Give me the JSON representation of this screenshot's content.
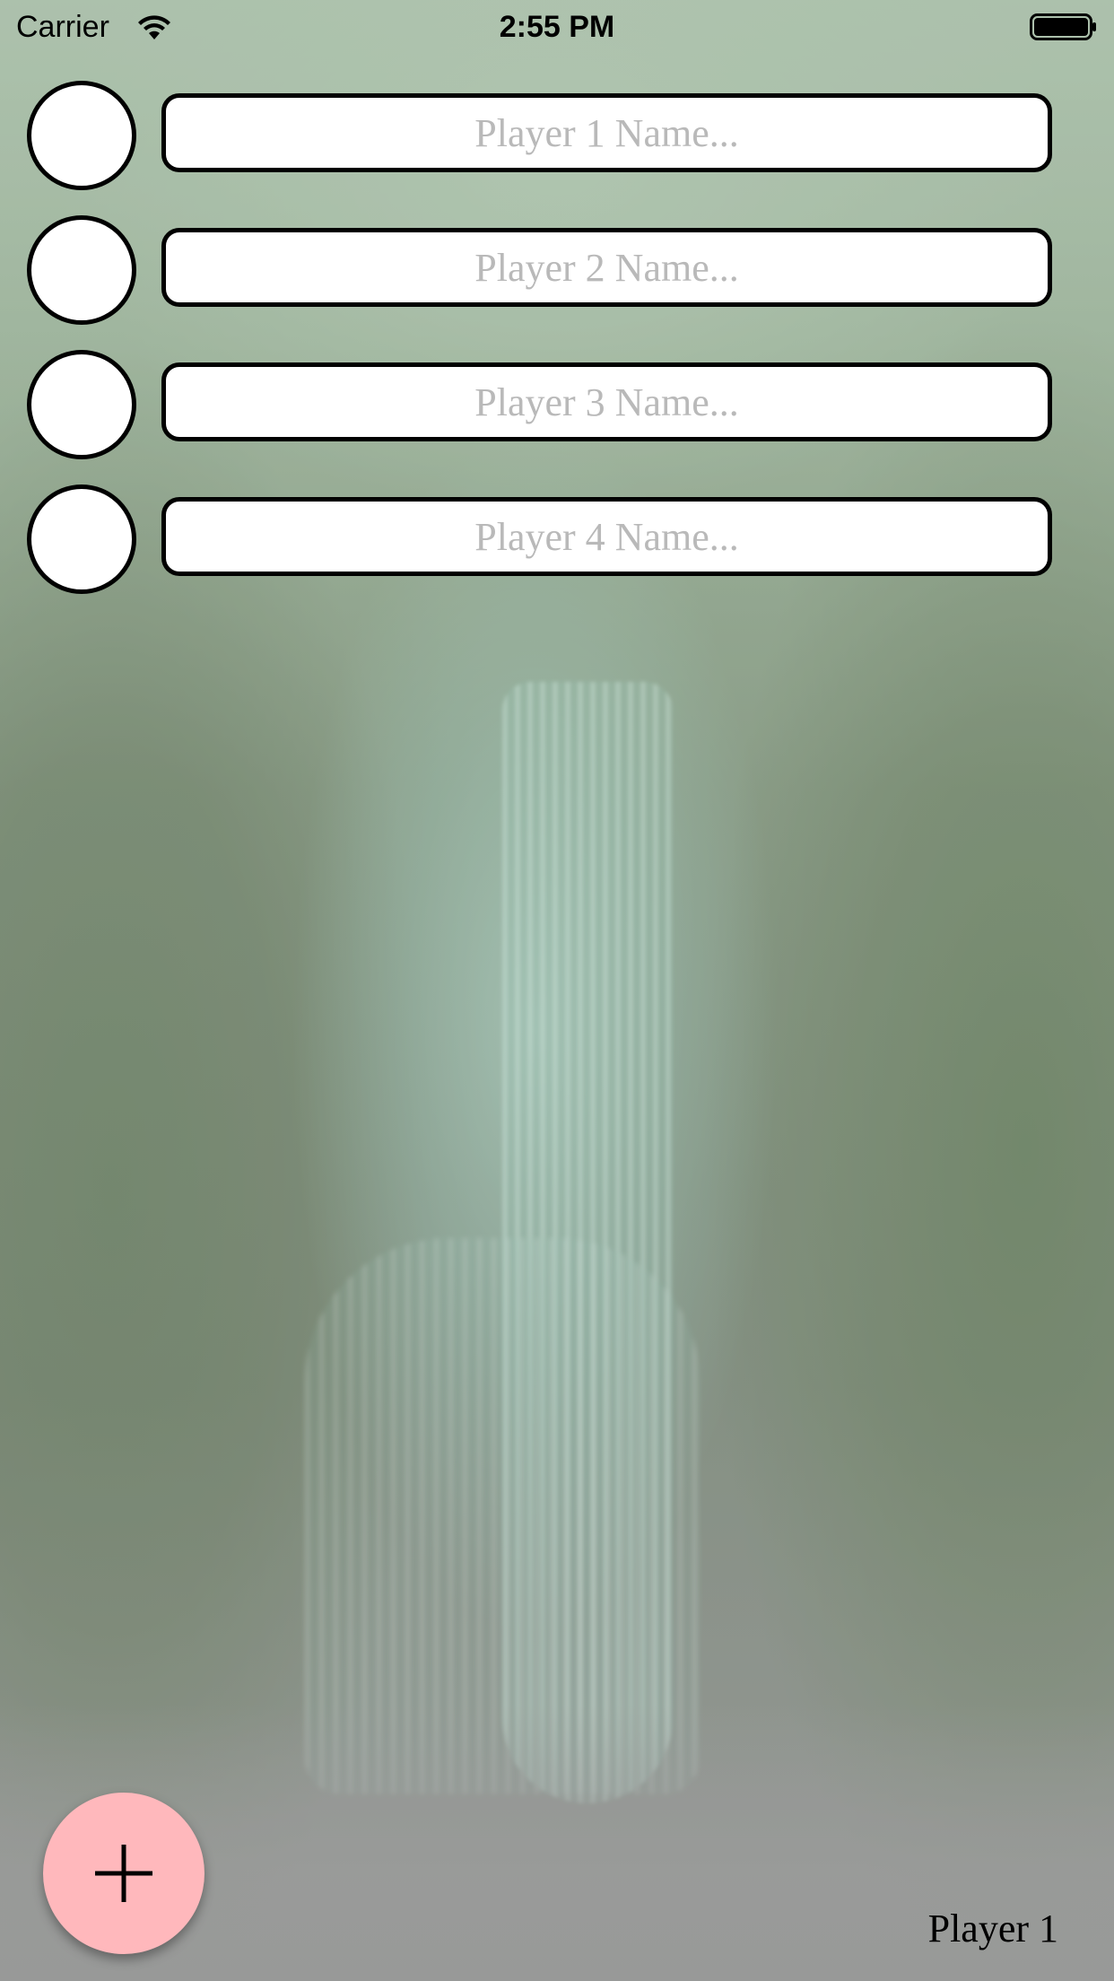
{
  "status_bar": {
    "carrier": "Carrier",
    "time": "2:55 PM",
    "wifi_icon": "wifi-icon",
    "battery_icon": "battery-full-icon"
  },
  "players": [
    {
      "placeholder": "Player 1 Name...",
      "value": ""
    },
    {
      "placeholder": "Player 2 Name...",
      "value": ""
    },
    {
      "placeholder": "Player 3 Name...",
      "value": ""
    },
    {
      "placeholder": "Player 4 Name...",
      "value": ""
    }
  ],
  "add_button": {
    "icon": "plus-icon",
    "color": "#ffb8bc"
  },
  "current_player": "Player 1"
}
